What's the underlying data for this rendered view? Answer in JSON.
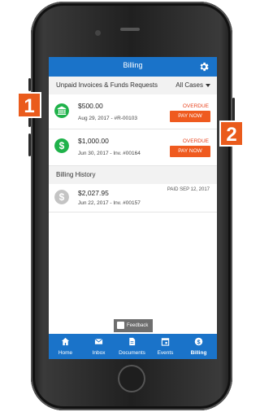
{
  "header": {
    "title": "Billing"
  },
  "unpaid": {
    "heading": "Unpaid Invoices & Funds Requests",
    "filter": "All Cases",
    "items": [
      {
        "amount": "$500.00",
        "meta": "Aug 29, 2017 - #R-00103",
        "status": "OVERDUE",
        "action": "PAY NOW",
        "icon": "bank-icon"
      },
      {
        "amount": "$1,000.00",
        "meta": "Jun 30, 2017 - Inv. #00164",
        "status": "OVERDUE",
        "action": "PAY NOW",
        "icon": "dollar-icon"
      }
    ]
  },
  "history": {
    "heading": "Billing History",
    "items": [
      {
        "amount": "$2,027.95",
        "meta": "Jun 22, 2017 - Inv. #00157",
        "status": "PAID SEP 12, 2017",
        "icon": "dollar-icon"
      }
    ]
  },
  "feedback": {
    "label": "Feedback"
  },
  "tabs": [
    {
      "label": "Home",
      "icon": "home-icon"
    },
    {
      "label": "Inbox",
      "icon": "mail-icon"
    },
    {
      "label": "Documents",
      "icon": "document-icon"
    },
    {
      "label": "Events",
      "icon": "calendar-icon"
    },
    {
      "label": "Billing",
      "icon": "billing-icon",
      "active": true
    }
  ],
  "callouts": [
    "1",
    "2"
  ],
  "colors": {
    "primary": "#1a73c9",
    "accent": "#ef5a1f",
    "success": "#1fb24a",
    "muted": "#c4c4c4"
  }
}
